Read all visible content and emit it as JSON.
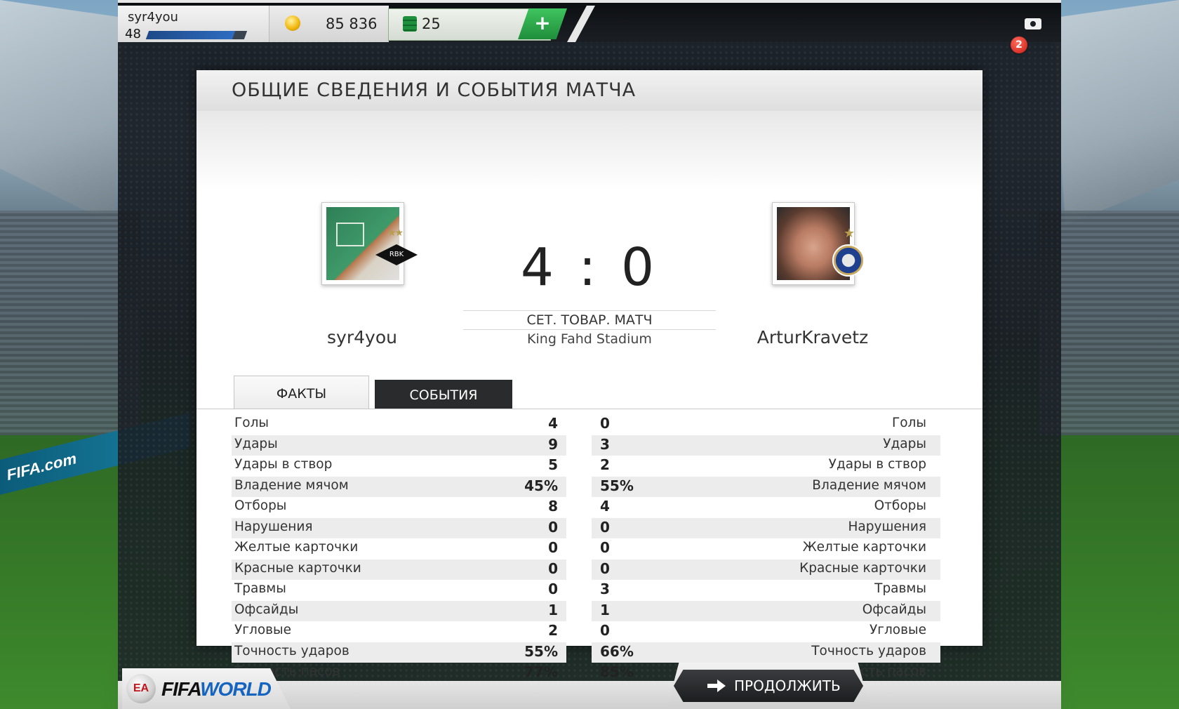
{
  "topbar": {
    "username": "syr4you",
    "level": "48",
    "xp_progress_percent": 88,
    "coins": "85 836",
    "points": "25",
    "add_label": "+",
    "notification_count": "2"
  },
  "panel": {
    "title": "ОБЩИЕ СВЕДЕНИЯ И СОБЫТИЯ МАТЧА"
  },
  "match": {
    "home_team": "syr4you",
    "away_team": "ArturKravetz",
    "score": "4 : 0",
    "type": "СЕТ. ТОВАР. МАТЧ",
    "stadium": "King Fahd Stadium",
    "home_crest_text": "RBK",
    "home_stars": "★★",
    "away_stars": "★"
  },
  "tabs": {
    "facts": "ФАКТЫ",
    "events": "СОБЫТИЯ"
  },
  "stats": [
    {
      "label": "Голы",
      "home": "4",
      "away": "0"
    },
    {
      "label": "Удары",
      "home": "9",
      "away": "3"
    },
    {
      "label": "Удары в створ",
      "home": "5",
      "away": "2"
    },
    {
      "label": "Владение мячом",
      "home": "45%",
      "away": "55%"
    },
    {
      "label": "Отборы",
      "home": "8",
      "away": "4"
    },
    {
      "label": "Нарушения",
      "home": "0",
      "away": "0"
    },
    {
      "label": "Желтые карточки",
      "home": "0",
      "away": "0"
    },
    {
      "label": "Красные карточки",
      "home": "0",
      "away": "0"
    },
    {
      "label": "Травмы",
      "home": "0",
      "away": "3"
    },
    {
      "label": "Офсайды",
      "home": "1",
      "away": "1"
    },
    {
      "label": "Угловые",
      "home": "2",
      "away": "0"
    },
    {
      "label": "Точность ударов",
      "home": "55%",
      "away": "66%"
    },
    {
      "label": "Точность пасов",
      "home": "77%",
      "away": "85%"
    }
  ],
  "footer": {
    "continue_label": "ПРОДОЛЖИТЬ",
    "ea_text": "EA",
    "fifa_text": "FIFA",
    "world_text": "WORLD"
  },
  "scenery": {
    "ad_text": "FIFA.com"
  },
  "colors": {
    "accent_green": "#1f8e3b",
    "badge_red": "#c81a12",
    "xp_blue": "#2f6cc0"
  }
}
